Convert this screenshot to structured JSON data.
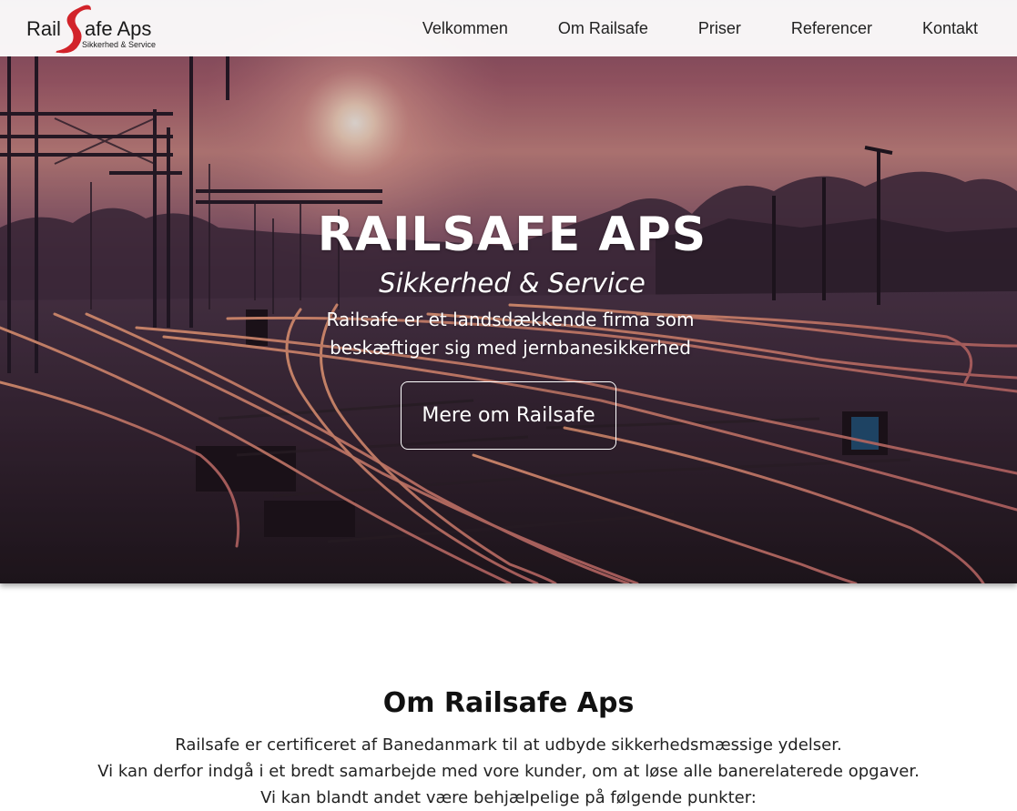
{
  "header": {
    "logo": {
      "name": "RailSafe Aps",
      "tagline": "Sikkerhed & Service"
    },
    "nav": [
      {
        "label": "Velkommen"
      },
      {
        "label": "Om Railsafe"
      },
      {
        "label": "Priser"
      },
      {
        "label": "Referencer"
      },
      {
        "label": "Kontakt"
      }
    ]
  },
  "hero": {
    "title": "RAILSAFE APS",
    "subtitle": "Sikkerhed & Service",
    "lede": "Railsafe er et landsdækkende firma som beskæftiger sig med jernbanesikkerhed",
    "button_label": "Mere om Railsafe",
    "background": "railway-tracks-at-sunset-photo"
  },
  "about": {
    "title": "Om Railsafe Aps",
    "lines": [
      "Railsafe er certificeret af Banedanmark til at udbyde sikkerhedsmæssige ydelser.",
      "Vi kan derfor indgå i et bredt samarbejde med vore kunder, om at løse alle banerelaterede opgaver.",
      "Vi kan blandt andet være behjælpelige på følgende punkter:"
    ]
  },
  "colors": {
    "brand_red": "#d2232a",
    "text_dark": "#222222",
    "hero_text": "#ffffff"
  }
}
